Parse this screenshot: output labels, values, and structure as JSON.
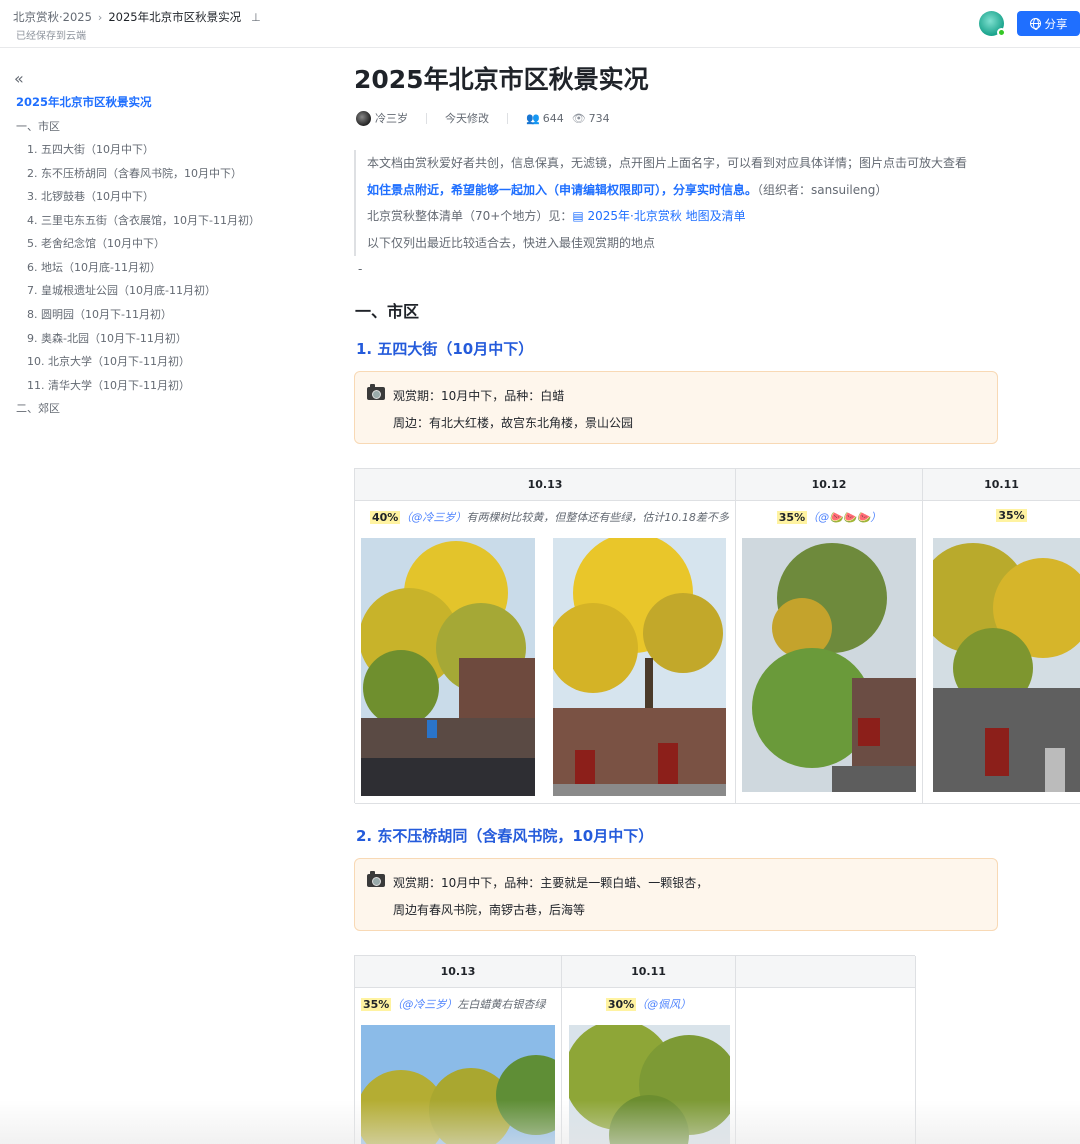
{
  "topbar": {
    "breadcrumb_parent": "北京赏秋·2025",
    "breadcrumb_current": "2025年北京市区秋景实况",
    "saved_status": "已经保存到云端",
    "share_label": "分享"
  },
  "sidebar": {
    "title": "2025年北京市区秋景实况",
    "items": [
      "一、市区",
      "1. 五四大街（10月中下）",
      "2. 东不压桥胡同（含春风书院，10月中下）",
      "3. 北锣鼓巷（10月中下）",
      "4. 三里屯东五街（含衣展馆，10月下-11月初）",
      "5. 老舍纪念馆（10月中下）",
      "6. 地坛（10月底-11月初）",
      "7. 皇城根遗址公园（10月底-11月初）",
      "8. 圆明园（10月下-11月初）",
      "9. 奥森-北园（10月下-11月初）",
      "10. 北京大学（10月下-11月初）",
      "11. 清华大学（10月下-11月初）",
      "二、郊区"
    ]
  },
  "doc": {
    "title": "2025年北京市区秋景实况",
    "author": "冷三岁",
    "modified": "今天修改",
    "collaborators": "644",
    "views": "734",
    "intro": {
      "line1": "本文档由赏秋爱好者共创，信息保真，无滤镜，点开图片上面名字，可以看到对应具体详情；图片点击可放大查看",
      "line2_bold": "如住景点附近，希望能够一起加入（申请编辑权限即可），分享实时信息。",
      "line2_rest": "（组织者：sansuileng）",
      "line3_prefix": "北京赏秋整体清单（70+个地方）见：",
      "line3_link": "2025年·北京赏秋 地图及清单",
      "line4": "以下仅列出最近比较适合去，快进入最佳观赏期的地点"
    },
    "dash": "-",
    "section1": "一、市区",
    "spots": [
      {
        "heading": "1. 五四大街（10月中下）",
        "callout": [
          "观赏期：10月中下，品种：白蜡",
          "周边：有北大红楼，故宫东北角楼，景山公园"
        ],
        "columns": [
          {
            "date": "10.13",
            "pct": "40%",
            "by": "（@冷三岁）",
            "note": "有两棵树比较黄，但整体还有些绿，估计10.18差不多"
          },
          {
            "date": "10.12",
            "pct": "35%",
            "by": "（@🍉🍉🍉）",
            "note": ""
          },
          {
            "date": "10.11",
            "pct": "35%",
            "by": "",
            "note": ""
          }
        ]
      },
      {
        "heading": "2. 东不压桥胡同（含春风书院，10月中下）",
        "callout": [
          "观赏期：10月中下，品种：主要就是一颗白蜡、一颗银杏，",
          "周边有春风书院，南锣古巷，后海等"
        ],
        "columns": [
          {
            "date": "10.13",
            "pct": "35%",
            "by": "（@冷三岁）",
            "note": "左白蜡黄右银杏绿"
          },
          {
            "date": "10.11",
            "pct": "30%",
            "by": "（@佩风）",
            "note": ""
          },
          {
            "date": "",
            "pct": "",
            "by": "",
            "note": ""
          }
        ]
      }
    ]
  },
  "colors": {
    "accent": "#1f6fff",
    "heading_blue": "#245bdb",
    "callout_bg": "#fef6ec",
    "highlight": "#fff3a1"
  }
}
